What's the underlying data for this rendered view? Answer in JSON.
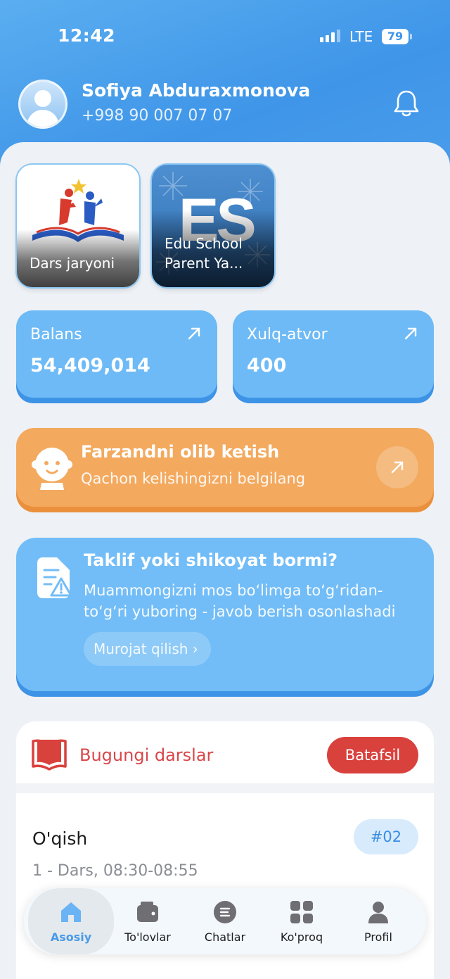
{
  "status_bar": {
    "time": "12:42",
    "network": "LTE",
    "battery": "79"
  },
  "profile": {
    "name": "Sofiya Abduraxmonova",
    "phone": "+998 90 007 07 07"
  },
  "apps": [
    {
      "label": "Dars jaryoni"
    },
    {
      "label": "Edu School Parent Ya...",
      "logo_text": "ES"
    }
  ],
  "stats": [
    {
      "title": "Balans",
      "value": "54,409,014"
    },
    {
      "title": "Xulq-atvor",
      "value": "400"
    }
  ],
  "pickup": {
    "title": "Farzandni olib ketish",
    "subtitle": "Qachon kelishingizni belgilang"
  },
  "feedback": {
    "title": "Taklif yoki shikoyat bormi?",
    "subtitle": "Muammongizni mos bo‘limga to‘g‘ridan-to‘g‘ri yuboring - javob berish osonlashadi",
    "button": "Murojat qilish"
  },
  "lessons": {
    "title": "Bugungi darslar",
    "details_button": "Batafsil",
    "items": [
      {
        "name": "O'qish",
        "time": "1 - Dars, 08:30-08:55",
        "number": "#02"
      }
    ]
  },
  "tabs": [
    {
      "label": "Asosiy",
      "icon": "home-icon",
      "active": true
    },
    {
      "label": "To'lovlar",
      "icon": "wallet-icon"
    },
    {
      "label": "Chatlar",
      "icon": "chat-icon"
    },
    {
      "label": "Ko'proq",
      "icon": "grid-icon"
    },
    {
      "label": "Profil",
      "icon": "person-icon"
    }
  ],
  "colors": {
    "header": "#4a9fec",
    "stat_card": "#6dbaf6",
    "pickup_card": "#f3a95e",
    "feedback_card": "#72bdf7",
    "lessons_accent": "#d9413d",
    "tab_active": "#4a9ae6"
  }
}
